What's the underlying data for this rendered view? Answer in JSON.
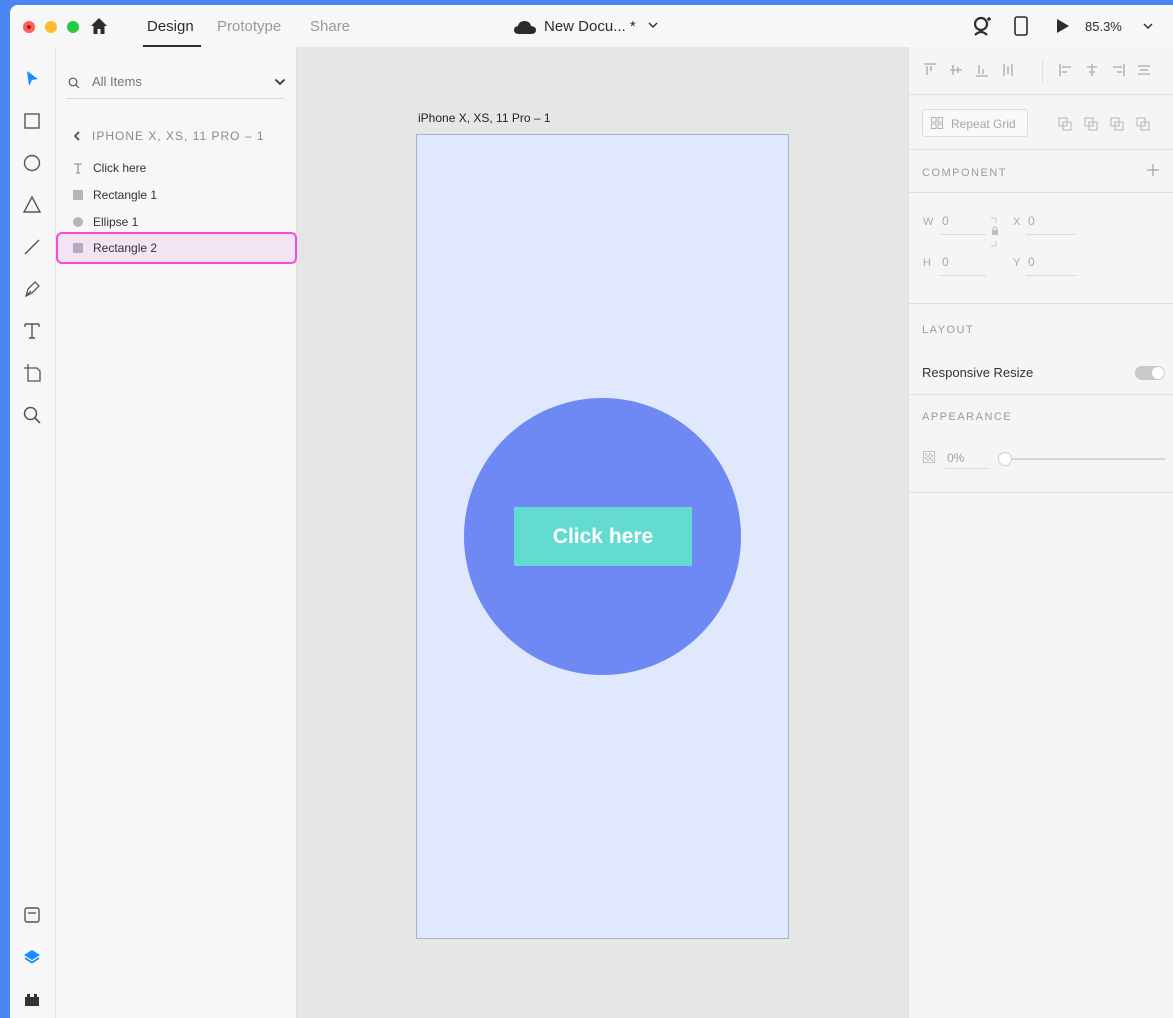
{
  "titlebar": {
    "tabs": [
      "Design",
      "Prototype",
      "Share"
    ],
    "document_title": "New Docu... *",
    "zoom": "85.3%"
  },
  "layers": {
    "search_placeholder": "All Items",
    "breadcrumb": "IPHONE X, XS, 11 PRO – 1",
    "items": [
      {
        "label": "Click here",
        "icon": "text-icon"
      },
      {
        "label": "Rectangle 1",
        "icon": "rectangle-icon"
      },
      {
        "label": "Ellipse 1",
        "icon": "ellipse-icon"
      },
      {
        "label": "Rectangle 2",
        "icon": "rectangle-icon",
        "selected": true
      }
    ]
  },
  "canvas": {
    "artboard_title": "iPhone X, XS, 11 Pro – 1",
    "button_text": "Click here",
    "colors": {
      "artboard": "#dfe8fc",
      "ellipse": "#6e89f3",
      "button": "#64dbd0"
    }
  },
  "properties": {
    "repeat_grid": "Repeat Grid",
    "component_title": "COMPONENT",
    "w_label": "W",
    "w_value": "0",
    "h_label": "H",
    "h_value": "0",
    "x_label": "X",
    "x_value": "0",
    "y_label": "Y",
    "y_value": "0",
    "layout_title": "LAYOUT",
    "responsive_resize": "Responsive Resize",
    "responsive_resize_on": true,
    "appearance_title": "APPEARANCE",
    "opacity": "0%"
  },
  "accent_highlight": "#f74ad6"
}
